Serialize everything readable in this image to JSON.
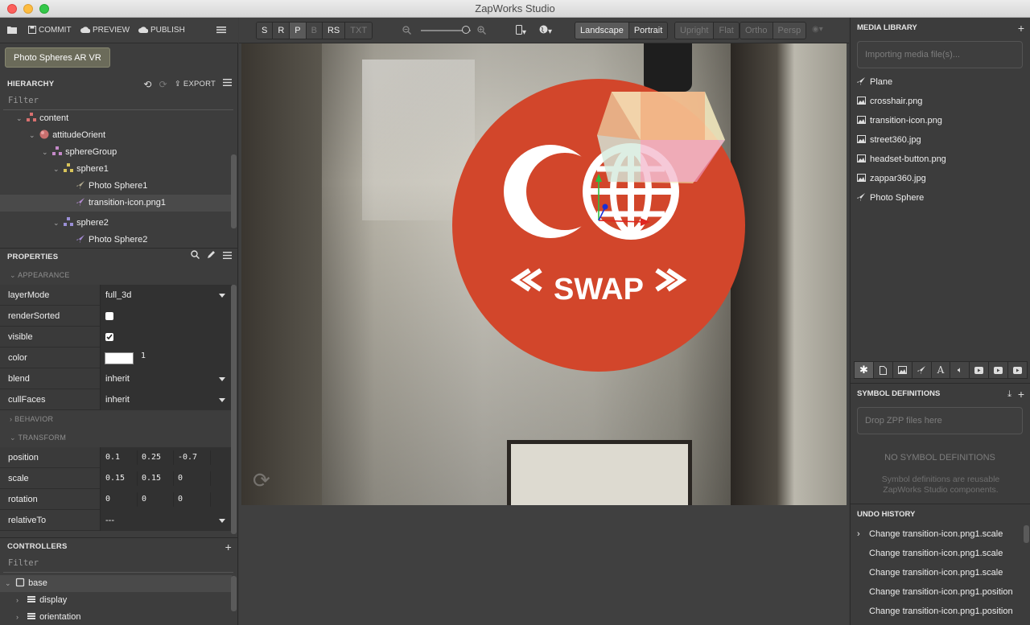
{
  "window": {
    "title": "ZapWorks Studio"
  },
  "toolbar": {
    "commit": "COMMIT",
    "preview": "PREVIEW",
    "publish": "PUBLISH"
  },
  "project": {
    "name": "Photo Spheres AR VR"
  },
  "hierarchy": {
    "title": "HIERARCHY",
    "export": "EXPORT",
    "filter": "Filter",
    "items": [
      {
        "label": "content"
      },
      {
        "label": "attitudeOrient"
      },
      {
        "label": "sphereGroup"
      },
      {
        "label": "sphere1"
      },
      {
        "label": "Photo Sphere1"
      },
      {
        "label": "transition-icon.png1"
      },
      {
        "label": "sphere2"
      },
      {
        "label": "Photo Sphere2"
      }
    ]
  },
  "properties": {
    "title": "PROPERTIES",
    "appearance": "APPEARANCE",
    "behavior": "BEHAVIOR",
    "transform": "TRANSFORM",
    "layerMode": {
      "label": "layerMode",
      "value": "full_3d"
    },
    "renderSorted": {
      "label": "renderSorted",
      "checked": false
    },
    "visible": {
      "label": "visible",
      "checked": true
    },
    "color": {
      "label": "color",
      "swatch": "#ffffff",
      "alpha": "1"
    },
    "blend": {
      "label": "blend",
      "value": "inherit"
    },
    "cullFaces": {
      "label": "cullFaces",
      "value": "inherit"
    },
    "position": {
      "label": "position",
      "x": "0.1",
      "y": "0.25",
      "z": "-0.7"
    },
    "scale": {
      "label": "scale",
      "x": "0.15",
      "y": "0.15",
      "z": "0"
    },
    "rotation": {
      "label": "rotation",
      "x": "0",
      "y": "0",
      "z": "0"
    },
    "relativeTo": {
      "label": "relativeTo",
      "value": "---"
    }
  },
  "controllers": {
    "title": "CONTROLLERS",
    "filter": "Filter",
    "items": [
      {
        "label": "base"
      },
      {
        "label": "display"
      },
      {
        "label": "orientation"
      }
    ]
  },
  "viewport_toolbar": {
    "modes": [
      "S",
      "R",
      "P",
      "B",
      "RS",
      "TXT"
    ],
    "landscape": "Landscape",
    "portrait": "Portrait",
    "upright": "Upright",
    "flat": "Flat",
    "ortho": "Ortho",
    "persp": "Persp",
    "zoom_level": 0.9
  },
  "viewport": {
    "swap_label": "SWAP",
    "accent": "#d2462b"
  },
  "media_library": {
    "title": "MEDIA LIBRARY",
    "import_placeholder": "Importing media file(s)...",
    "items": [
      {
        "label": "Plane",
        "icon": "rocket-icon"
      },
      {
        "label": "crosshair.png",
        "icon": "image-icon"
      },
      {
        "label": "transition-icon.png",
        "icon": "image-icon"
      },
      {
        "label": "street360.jpg",
        "icon": "image-icon"
      },
      {
        "label": "headset-button.png",
        "icon": "image-icon"
      },
      {
        "label": "zappar360.jpg",
        "icon": "image-icon"
      },
      {
        "label": "Photo Sphere",
        "icon": "rocket-icon"
      }
    ]
  },
  "symbol_definitions": {
    "title": "SYMBOL DEFINITIONS",
    "drop_placeholder": "Drop ZPP files here",
    "empty_title": "NO SYMBOL DEFINITIONS",
    "empty_desc": "Symbol definitions are reusable ZapWorks Studio components."
  },
  "undo_history": {
    "title": "UNDO HISTORY",
    "items": [
      "Change transition-icon.png1.scale",
      "Change transition-icon.png1.scale",
      "Change transition-icon.png1.scale",
      "Change transition-icon.png1.position",
      "Change transition-icon.png1.position"
    ]
  }
}
